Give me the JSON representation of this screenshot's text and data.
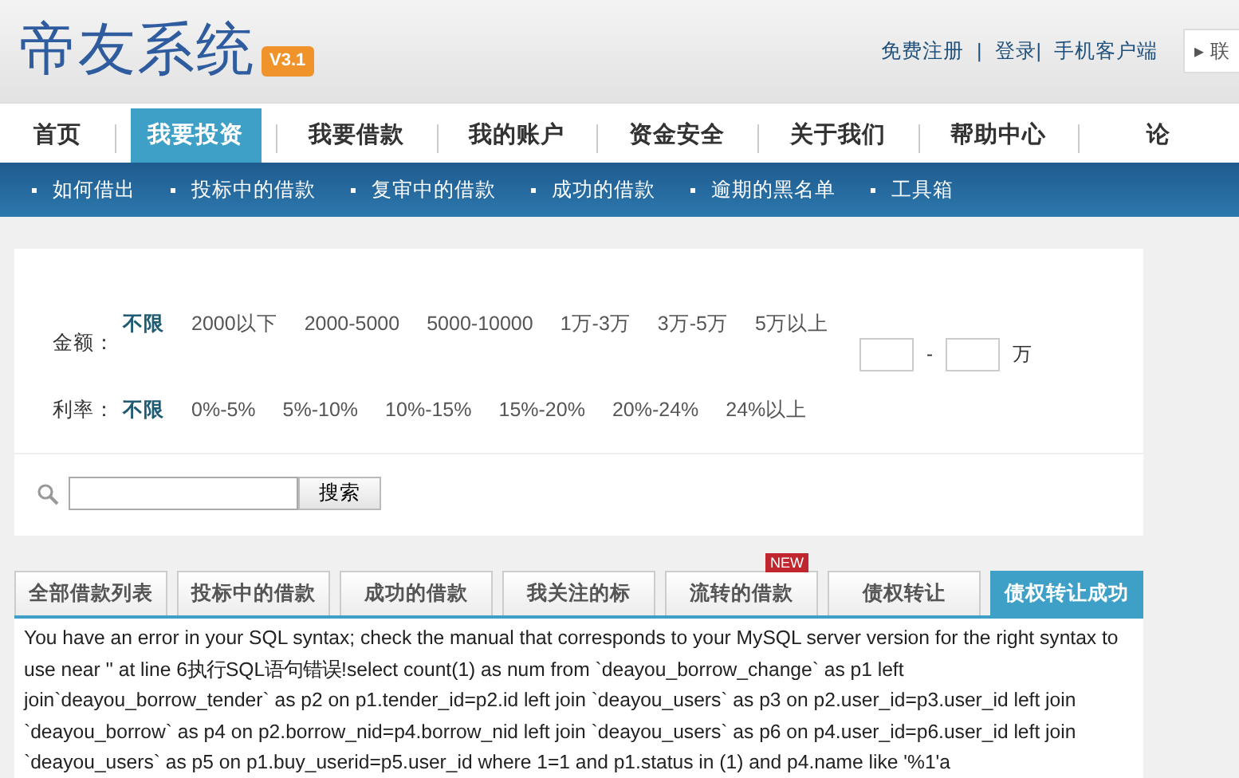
{
  "header": {
    "logo": "帝友系统",
    "version": "V3.1",
    "links": [
      {
        "label": "免费注册"
      },
      {
        "label": "|"
      },
      {
        "label": "登录|"
      },
      {
        "label": "手机客户端"
      }
    ],
    "corner_box": {
      "icon": "▸",
      "label": "联"
    }
  },
  "nav": [
    {
      "label": "首页",
      "selected": false
    },
    {
      "label": "我要投资",
      "selected": true
    },
    {
      "label": "我要借款",
      "selected": false
    },
    {
      "label": "我的账户",
      "selected": false
    },
    {
      "label": "资金安全",
      "selected": false
    },
    {
      "label": "关于我们",
      "selected": false
    },
    {
      "label": "帮助中心",
      "selected": false
    },
    {
      "label": "论",
      "selected": false
    }
  ],
  "subnav": [
    "如何借出",
    "投标中的借款",
    "复审中的借款",
    "成功的借款",
    "逾期的黑名单",
    "工具箱"
  ],
  "filters": [
    {
      "label": "金额：",
      "options": [
        {
          "label": "不限",
          "selected": true
        },
        {
          "label": "2000以下",
          "selected": false
        },
        {
          "label": "2000-5000",
          "selected": false
        },
        {
          "label": "5000-10000",
          "selected": false
        },
        {
          "label": "1万-3万",
          "selected": false
        },
        {
          "label": "3万-5万",
          "selected": false
        },
        {
          "label": "5万以上",
          "selected": false
        }
      ]
    },
    {
      "label": "利率：",
      "options": [
        {
          "label": "不限",
          "selected": true
        },
        {
          "label": "0%-5%",
          "selected": false
        },
        {
          "label": "5%-10%",
          "selected": false
        },
        {
          "label": "10%-15%",
          "selected": false
        },
        {
          "label": "15%-20%",
          "selected": false
        },
        {
          "label": "20%-24%",
          "selected": false
        },
        {
          "label": "24%以上",
          "selected": false
        }
      ]
    }
  ],
  "range": {
    "separator": "-",
    "unit": "万"
  },
  "search": {
    "button": "搜索"
  },
  "tabs": [
    {
      "label": "全部借款列表",
      "selected": false
    },
    {
      "label": "投标中的借款",
      "selected": false
    },
    {
      "label": "成功的借款",
      "selected": false
    },
    {
      "label": "我关注的标",
      "selected": false
    },
    {
      "label": "流转的借款",
      "selected": false,
      "badge": "NEW"
    },
    {
      "label": "债权转让",
      "selected": false
    },
    {
      "label": "债权转让成功",
      "selected": true
    }
  ],
  "error_message": "You have an error in your SQL syntax; check the manual that corresponds to your MySQL server version for the right syntax to use near '' at line 6执行SQL语句错误!select count(1) as num from `deayou_borrow_change` as p1 left join`deayou_borrow_tender` as p2 on p1.tender_id=p2.id left join `deayou_users` as p3 on p2.user_id=p3.user_id left join `deayou_borrow` as p4 on p2.borrow_nid=p4.borrow_nid left join `deayou_users` as p6 on p4.user_id=p6.user_id left join `deayou_users` as p5 on p1.buy_userid=p5.user_id where 1=1 and p1.status in (1) and p4.name like '%1'a"
}
